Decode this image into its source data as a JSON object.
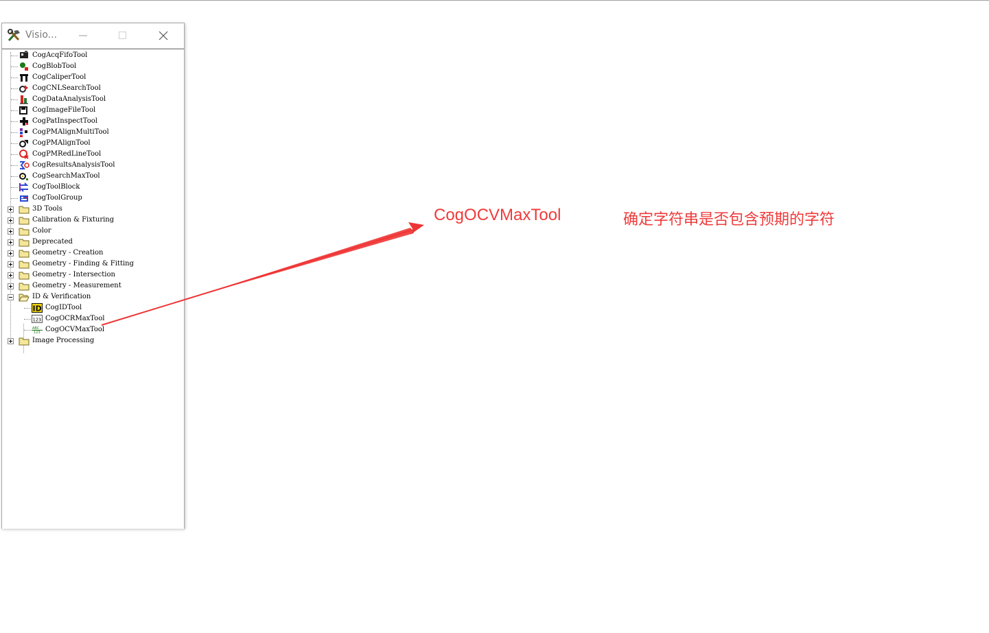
{
  "window": {
    "title": "Visio..."
  },
  "tree": {
    "tools": [
      {
        "label": "CogAcqFifoTool",
        "icon": "acq-fifo-icon"
      },
      {
        "label": "CogBlobTool",
        "icon": "blob-icon"
      },
      {
        "label": "CogCaliperTool",
        "icon": "caliper-icon"
      },
      {
        "label": "CogCNLSearchTool",
        "icon": "cnl-search-icon"
      },
      {
        "label": "CogDataAnalysisTool",
        "icon": "data-analysis-icon"
      },
      {
        "label": "CogImageFileTool",
        "icon": "image-file-icon"
      },
      {
        "label": "CogPatInspectTool",
        "icon": "pat-inspect-icon"
      },
      {
        "label": "CogPMAlignMultiTool",
        "icon": "pmalign-multi-icon"
      },
      {
        "label": "CogPMAlignTool",
        "icon": "pmalign-icon"
      },
      {
        "label": "CogPMRedLineTool",
        "icon": "pm-redline-icon"
      },
      {
        "label": "CogResultsAnalysisTool",
        "icon": "results-analysis-icon"
      },
      {
        "label": "CogSearchMaxTool",
        "icon": "search-max-icon"
      },
      {
        "label": "CogToolBlock",
        "icon": "tool-block-icon"
      },
      {
        "label": "CogToolGroup",
        "icon": "tool-group-icon"
      }
    ],
    "folders": [
      {
        "label": "3D Tools",
        "expanded": false
      },
      {
        "label": "Calibration & Fixturing",
        "expanded": false
      },
      {
        "label": "Color",
        "expanded": false
      },
      {
        "label": "Deprecated",
        "expanded": false
      },
      {
        "label": "Geometry - Creation",
        "expanded": false
      },
      {
        "label": "Geometry - Finding & Fitting",
        "expanded": false
      },
      {
        "label": "Geometry - Intersection",
        "expanded": false
      },
      {
        "label": "Geometry - Measurement",
        "expanded": false
      },
      {
        "label": "ID & Verification",
        "expanded": true
      },
      {
        "label": "Image Processing",
        "expanded": false
      }
    ],
    "id_children": [
      {
        "label": "CogIDTool",
        "icon": "id-tool-icon"
      },
      {
        "label": "CogOCRMaxTool",
        "icon": "ocr-max-icon"
      },
      {
        "label": "CogOCVMaxTool",
        "icon": "ocv-max-icon"
      }
    ]
  },
  "annotation": {
    "title": "CogOCVMaxTool",
    "description": "确定字符串是否包含预期的字符",
    "color": "#f03a3a"
  }
}
